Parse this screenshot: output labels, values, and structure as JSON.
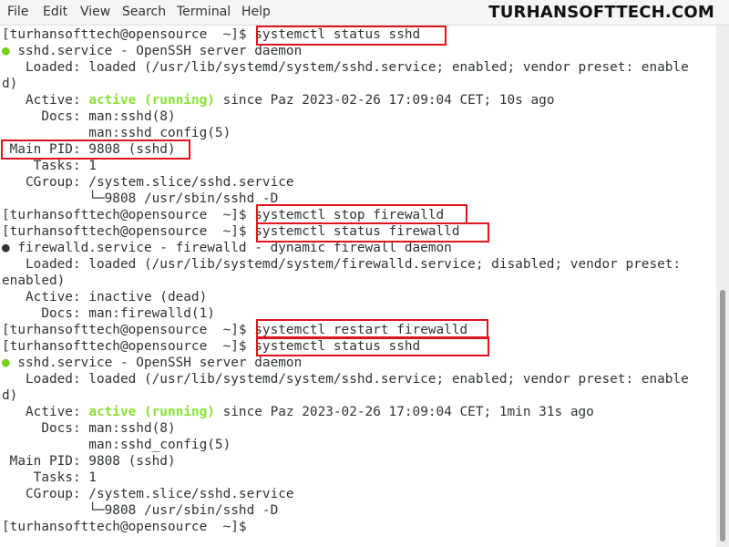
{
  "menu": {
    "file": "File",
    "edit": "Edit",
    "view": "View",
    "search": "Search",
    "terminal": "Terminal",
    "help": "Help"
  },
  "watermark": "TURHANSOFTTECH.COM",
  "terminal": {
    "prompt": "[turhansofttech@opensource  ~]$ ",
    "cmd1": "systemctl status sshd",
    "ssh1_title": "sshd.service - OpenSSH server daemon",
    "ssh1_loaded_a": "   Loaded: loaded (/usr/lib/systemd/system/sshd.service; enabled; vendor preset: enable",
    "ssh1_loaded_b": "d)",
    "ssh1_active_label": "   Active: ",
    "ssh1_active_status": "active (running)",
    "ssh1_active_rest": " since Paz 2023-02-26 17:09:04 CET; 10s ago",
    "ssh1_docs1": "     Docs: man:sshd(8)",
    "ssh1_docs2": "           man:sshd_config(5)",
    "ssh1_pid": " Main PID: 9808 (sshd)",
    "ssh1_tasks": "    Tasks: 1",
    "ssh1_cgroup": "   CGroup: /system.slice/sshd.service",
    "ssh1_tree": "           └─9808 /usr/sbin/sshd -D",
    "cmd2": "systemctl stop firewalld",
    "cmd3": "systemctl status firewalld",
    "fw_title": "firewalld.service - firewalld - dynamic firewall daemon",
    "fw_loaded_a": "   Loaded: loaded (/usr/lib/systemd/system/firewalld.service; disabled; vendor preset:",
    "fw_loaded_b": "enabled)",
    "fw_active": "   Active: inactive (dead)",
    "fw_docs": "     Docs: man:firewalld(1)",
    "cmd4": "systemctl restart firewalld",
    "cmd5": "systemctl status sshd",
    "ssh2_title": "sshd.service - OpenSSH server daemon",
    "ssh2_loaded_a": "   Loaded: loaded (/usr/lib/systemd/system/sshd.service; enabled; vendor preset: enable",
    "ssh2_loaded_b": "d)",
    "ssh2_active_label": "   Active: ",
    "ssh2_active_status": "active (running)",
    "ssh2_active_rest": " since Paz 2023-02-26 17:09:04 CET; 1min 31s ago",
    "ssh2_docs1": "     Docs: man:sshd(8)",
    "ssh2_docs2": "           man:sshd_config(5)",
    "ssh2_pid": " Main PID: 9808 (sshd)",
    "ssh2_tasks": "    Tasks: 1",
    "ssh2_cgroup": "   CGroup: /system.slice/sshd.service",
    "ssh2_tree": "           └─9808 /usr/sbin/sshd -D",
    "bullet": "● "
  },
  "colors": {
    "highlight": "#e0141e",
    "active_green": "#8ae234",
    "text": "#2e3436"
  }
}
